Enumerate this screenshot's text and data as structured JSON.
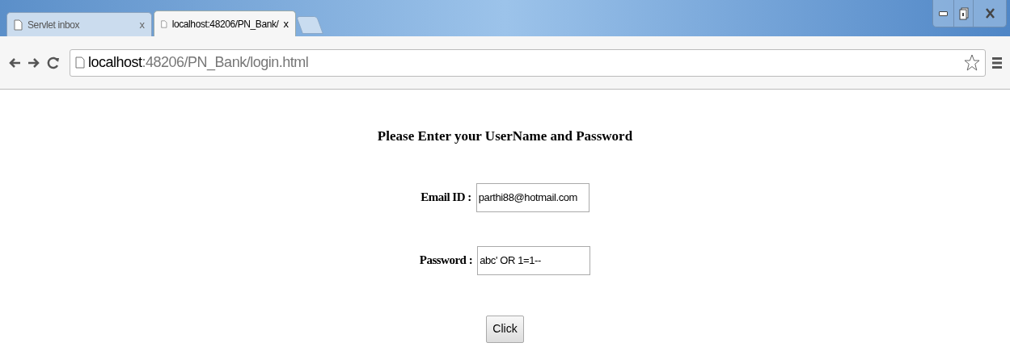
{
  "tabs": [
    {
      "title": "Servlet inbox",
      "close": "x",
      "selected": false
    },
    {
      "title": "localhost:48206/PN_Bank/",
      "close": "x",
      "selected": true
    }
  ],
  "address_bar": {
    "host": "localhost",
    "path": ":48206/PN_Bank/login.html"
  },
  "page": {
    "heading": "Please Enter your UserName and Password",
    "fields": [
      {
        "label": "Email ID :",
        "value": "parthi88@hotmail.com"
      },
      {
        "label": "Password :",
        "value": "abc' OR 1=1--"
      }
    ],
    "button": "Click"
  }
}
